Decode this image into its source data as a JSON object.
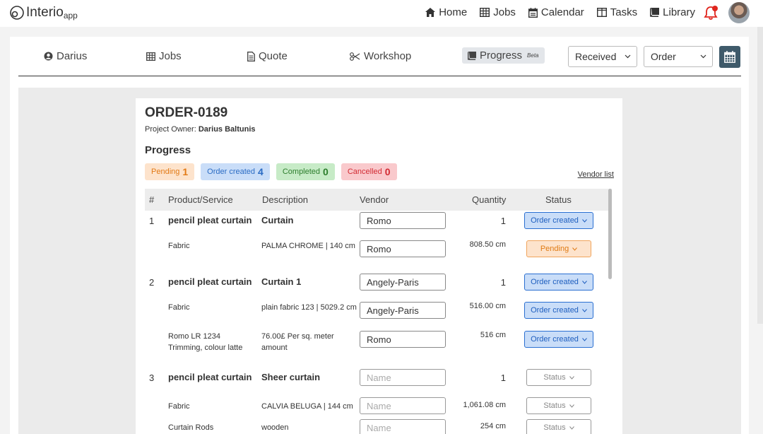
{
  "brand": {
    "name": "Interio",
    "suffix": "app"
  },
  "topnav": [
    {
      "label": "Home",
      "icon": "home-icon"
    },
    {
      "label": "Jobs",
      "icon": "table-icon"
    },
    {
      "label": "Calendar",
      "icon": "calendar-icon"
    },
    {
      "label": "Tasks",
      "icon": "columns-icon"
    },
    {
      "label": "Library",
      "icon": "book-icon"
    }
  ],
  "tabs": [
    {
      "label": "Darius",
      "icon": "user-icon"
    },
    {
      "label": "Jobs",
      "icon": "table-icon"
    },
    {
      "label": "Quote",
      "icon": "document-icon"
    },
    {
      "label": "Workshop",
      "icon": "scissors-icon"
    },
    {
      "label": "Progress",
      "icon": "book-icon",
      "badge": "Beta",
      "active": true
    }
  ],
  "filters": {
    "status_select": "Received",
    "type_select": "Order"
  },
  "order": {
    "title": "ORDER-0189",
    "owner_label": "Project Owner:",
    "owner_name": "Darius Baltunis",
    "progress_heading": "Progress",
    "vendor_list_link": "Vendor list",
    "summary": [
      {
        "label": "Pending",
        "count": "1",
        "color": "#e27a16"
      },
      {
        "label": "Order created",
        "count": "4",
        "color": "#2b6cc4"
      },
      {
        "label": "Completed",
        "count": "0",
        "color": "#2c7d2c"
      },
      {
        "label": "Cancelled",
        "count": "0",
        "color": "#d22b33"
      }
    ],
    "columns": [
      "#",
      "Product/Service",
      "Description",
      "Vendor",
      "Quantity",
      "Status"
    ],
    "rows": [
      {
        "num": "1",
        "product": "pencil pleat curtain",
        "description": "Curtain",
        "vendor": "Romo",
        "quantity": "1",
        "status": "Order created"
      },
      {
        "num": "",
        "product": "Fabric",
        "description": "PALMA CHROME | 140 cm",
        "vendor": "Romo",
        "quantity": "808.50 cm",
        "status": "Pending"
      },
      {
        "num": "2",
        "product": "pencil pleat curtain",
        "description": "Curtain 1",
        "vendor": "Angely-Paris",
        "quantity": "1",
        "status": "Order created"
      },
      {
        "num": "",
        "product": "Fabric",
        "description": "plain fabric 123 | 5029.2 cm",
        "vendor": "Angely-Paris",
        "quantity": "516.00 cm",
        "status": "Order created"
      },
      {
        "num": "",
        "product": "Romo LR 1234 Trimming, colour latte",
        "description": "76.00£ Per sq. meter amount",
        "vendor": "Romo",
        "quantity": "516 cm",
        "status": "Order created"
      },
      {
        "num": "3",
        "product": "pencil pleat curtain",
        "description": "Sheer curtain",
        "vendor": "",
        "quantity": "1",
        "status": "Status"
      },
      {
        "num": "",
        "product": "Fabric",
        "description": "CALVIA BELUGA | 144 cm",
        "vendor": "",
        "quantity": "1,061.08 cm",
        "status": "Status"
      },
      {
        "num": "",
        "product": "Curtain Rods",
        "description": "wooden",
        "vendor": "",
        "quantity": "254 cm",
        "status": "Status"
      }
    ],
    "vendor_placeholder": "Name"
  }
}
